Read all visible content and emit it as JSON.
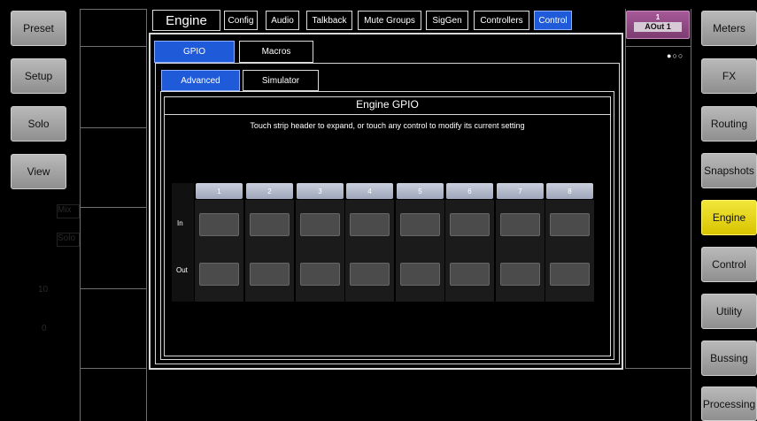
{
  "left_buttons": [
    {
      "label": "Preset"
    },
    {
      "label": "Setup"
    },
    {
      "label": "Solo"
    },
    {
      "label": "View"
    }
  ],
  "right_buttons": [
    {
      "label": "Meters"
    },
    {
      "label": "FX"
    },
    {
      "label": "Routing"
    },
    {
      "label": "Snapshots"
    },
    {
      "label": "Engine"
    },
    {
      "label": "Control"
    },
    {
      "label": "Utility"
    },
    {
      "label": "Bussing"
    },
    {
      "label": "Processing"
    }
  ],
  "background_labels": {
    "mix": "Mix",
    "solo": "Solo",
    "ten": "10",
    "zero": "0"
  },
  "top_tabs": {
    "title": "Engine",
    "tabs": [
      "Config",
      "Audio",
      "Talkback",
      "Mute Groups",
      "SigGen",
      "Controllers",
      "Control"
    ]
  },
  "channel_badge": {
    "number": "1",
    "name": "AOut 1"
  },
  "sub_tabs": [
    "GPIO",
    "Macros"
  ],
  "mode_tabs": [
    "Advanced",
    "Simulator"
  ],
  "panel": {
    "title": "Engine GPIO",
    "hint": "Touch strip header to expand, or touch any control to modify its current setting"
  },
  "gpio": {
    "columns": [
      "1",
      "2",
      "3",
      "4",
      "5",
      "6",
      "7",
      "8"
    ],
    "row_in": "In",
    "row_out": "Out"
  },
  "colors": {
    "accent_blue": "#1f5ad8",
    "active_yellow": "#e6d800",
    "badge": "#9a4a8a"
  }
}
